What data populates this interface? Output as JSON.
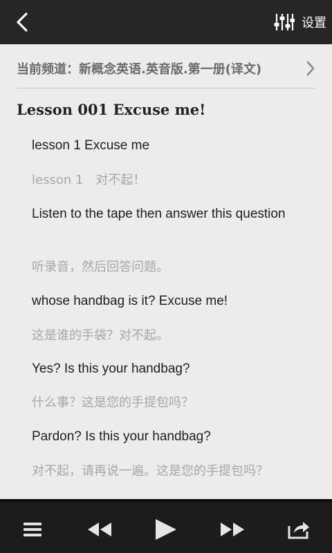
{
  "header": {
    "settings_label": "设置"
  },
  "channel": {
    "text": "当前频道：新概念英语.英音版.第一册(译文)"
  },
  "lesson": {
    "title": "Lesson 001 Excuse me!",
    "lines": [
      {
        "lang": "en",
        "text": "lesson 1 Excuse me"
      },
      {
        "lang": "cn",
        "text": "lesson 1　对不起！"
      },
      {
        "lang": "en",
        "text": "Listen to the tape then answer this question"
      },
      {
        "lang": "cn",
        "text": "听录音，然后回答问题。"
      },
      {
        "lang": "en",
        "text": "whose handbag is it?  Excuse me!"
      },
      {
        "lang": "cn",
        "text": "这是谁的手袋？对不起。"
      },
      {
        "lang": "en",
        "text": "Yes?  Is this your handbag?"
      },
      {
        "lang": "cn",
        "text": "什么事？这是您的手提包吗？"
      },
      {
        "lang": "en",
        "text": "Pardon?  Is this your handbag?"
      },
      {
        "lang": "cn",
        "text": "对不起，请再说一遍。这是您的手提包吗？"
      }
    ]
  },
  "player": {
    "controls": [
      "menu-icon",
      "rewind-icon",
      "play-icon",
      "fast-forward-icon",
      "share-icon"
    ]
  },
  "colors": {
    "topbar": "#262626",
    "background": "#ececec",
    "english_text": "#1e1e1e",
    "chinese_text": "#a6a6a6",
    "bottombar": "#1c1c1c"
  }
}
